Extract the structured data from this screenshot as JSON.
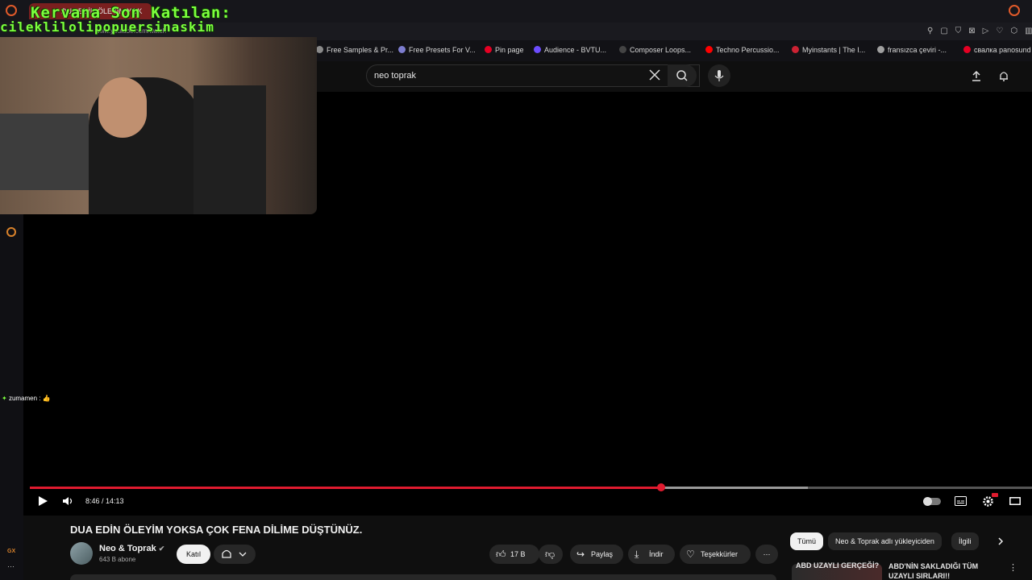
{
  "browser": {
    "tab_title": "DUA EDİN ÖLEYİM YOK",
    "url": "www.youtube.com/watch",
    "bookmarks": [
      {
        "label": "Free Samples & Pr...",
        "color": "#8a8a8a"
      },
      {
        "label": "Free Presets For V...",
        "color": "#7d7dcf"
      },
      {
        "label": "Pin page",
        "color": "#e60023"
      },
      {
        "label": "Audience - BVTU...",
        "color": "#6d4dff"
      },
      {
        "label": "Composer Loops...",
        "color": "#444444"
      },
      {
        "label": "Techno Percussio...",
        "color": "#ff0000"
      },
      {
        "label": "Myinstants | The I...",
        "color": "#cc2233"
      },
      {
        "label": "fransızca çeviri -...",
        "color": "#a0a0a0"
      },
      {
        "label": "свалка panosund",
        "color": "#e60023"
      }
    ]
  },
  "overlay": {
    "title": "Kervana Son Katılan:",
    "username": "cileklilolipopuersinaskim"
  },
  "chat": {
    "message": "zumamen :"
  },
  "search": {
    "value": "neo toprak"
  },
  "player": {
    "time": "8:46 / 14:13",
    "progress": 0.63
  },
  "video": {
    "title": "DUA EDİN ÖLEYİM YOKSA ÇOK FENA DİLİME DÜŞTÜNÜZ.",
    "channel": "Neo & Toprak",
    "subscribers": "643 B abone",
    "join_label": "Katıl",
    "likes": "17 B",
    "share_label": "Paylaş",
    "download_label": "İndir",
    "thanks_label": "Teşekkürler"
  },
  "chips": {
    "all": "Tümü",
    "uploader": "Neo & Toprak adlı yükleyiciden",
    "related": "İlgili"
  },
  "recommendations": [
    {
      "title": "ABD UZAYLI GERÇEĞİ?"
    },
    {
      "title": "ABD'NİN SAKLADIĞI TÜM"
    },
    {
      "title": "UZAYLI SIRLARI!!"
    }
  ],
  "rail": {
    "gx_label": "GX"
  },
  "colors": {
    "accent": "#e01b2f",
    "overlay_text": "#7cff3d"
  }
}
